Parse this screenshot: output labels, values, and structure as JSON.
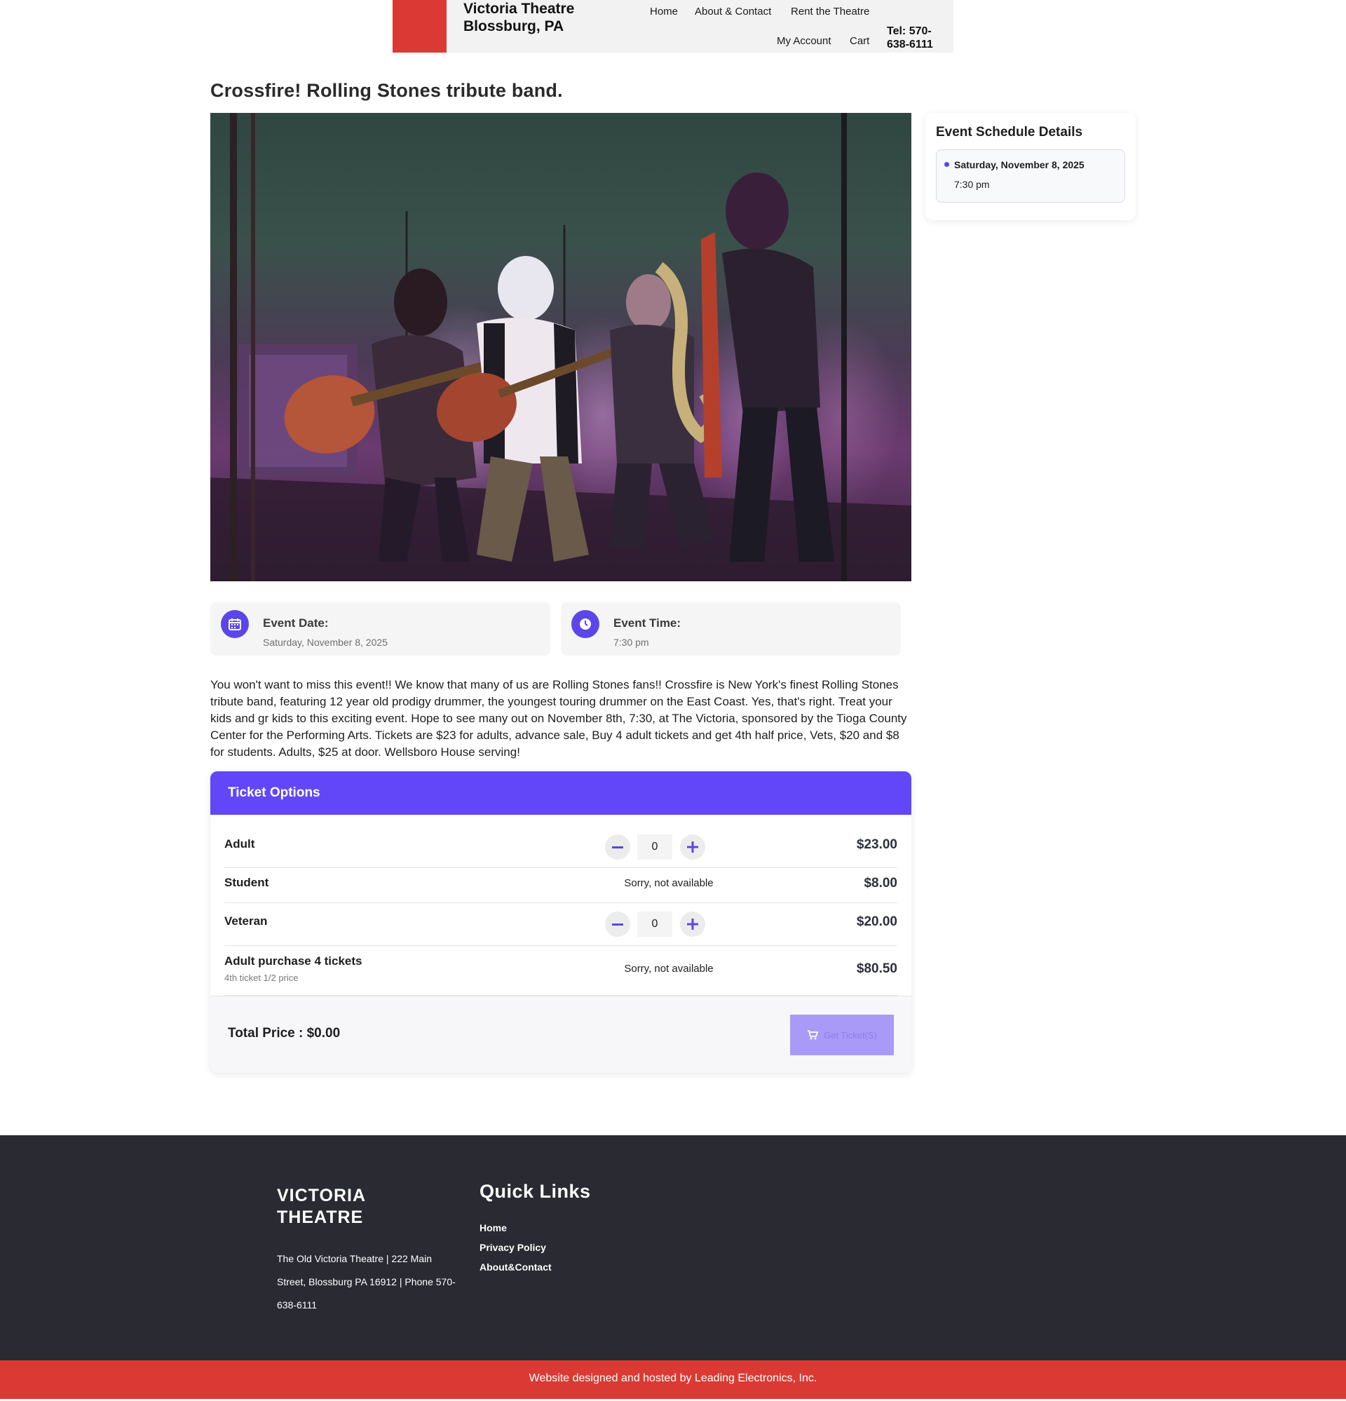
{
  "header": {
    "site_title": "Victoria Theatre Blossburg, PA",
    "nav": {
      "home": "Home",
      "about": "About & Contact",
      "rent": "Rent the Theatre",
      "account": "My Account",
      "cart": "Cart"
    },
    "tel": "Tel: 570-638-6111",
    "logo_color": "#db3a34"
  },
  "event": {
    "title": "Crossfire! Rolling Stones tribute band.",
    "date_label": "Event Date:",
    "date_value": "Saturday, November 8, 2025",
    "time_label": "Event Time:",
    "time_value": "7:30 pm",
    "description": "You won't want to miss this event!! We know that many of us are Rolling Stones fans!! Crossfire is New York's finest Rolling Stones tribute band, featuring 12 year old prodigy drummer, the youngest touring drummer on the East Coast. Yes, that's right.  Treat your kids and gr kids to this exciting event.  Hope to see many out on November 8th, 7:30, at The Victoria, sponsored by the Tioga County Center for the Performing Arts.  Tickets are $23 for adults, advance sale, Buy 4 adult tickets and get 4th half price, Vets, $20 and $8 for students. Adults, $25 at door.  Wellsboro House serving!"
  },
  "tickets": {
    "header": "Ticket Options",
    "accent_color": "#6147f7",
    "rows": [
      {
        "name": "Adult",
        "qty": "0",
        "price": "$23.00"
      },
      {
        "name": "Student",
        "status": "Sorry, not available",
        "price": "$8.00"
      },
      {
        "name": "Veteran",
        "qty": "0",
        "price": "$20.00"
      },
      {
        "name": "Adult purchase 4 tickets",
        "sub": "4th ticket 1/2 price",
        "status": "Sorry, not available",
        "price": "$80.50"
      }
    ],
    "total": "Total Price : $0.00",
    "button_label": "Get Ticket(S)"
  },
  "schedule": {
    "title": "Event Schedule Details",
    "date": "Saturday, November 8, 2025",
    "time": "7:30 pm"
  },
  "footer": {
    "brand": "VICTORIA THEATRE",
    "address": "The Old Victoria Theatre | 222 Main Street, Blossburg PA 16912 | Phone 570-638-6111",
    "quick_links_title": "Quick Links",
    "links": [
      "Home",
      "Privacy Policy",
      "About&Contact"
    ],
    "credit": "Website designed and hosted by Leading Electronics, Inc."
  },
  "icons": {
    "date": "calendar-icon",
    "time": "clock-icon",
    "minus": "minus-icon",
    "plus": "plus-icon",
    "cart": "cart-icon"
  }
}
